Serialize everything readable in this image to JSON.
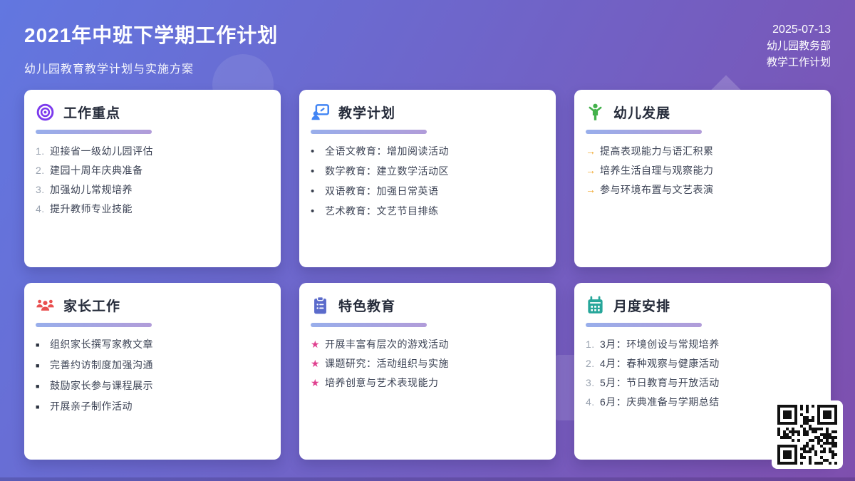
{
  "header": {
    "title": "2021年中班下学期工作计划",
    "subtitle": "幼儿园教育教学计划与实施方案",
    "date": "2025-07-13",
    "department": "幼儿园教务部",
    "doc_type": "教学工作计划"
  },
  "cards": [
    {
      "title": "工作重点",
      "icon": "target-icon",
      "icon_color": "#7c3aed",
      "marker": "number",
      "items": [
        "迎接省一级幼儿园评估",
        "建园十周年庆典准备",
        "加强幼儿常规培养",
        "提升教师专业技能"
      ]
    },
    {
      "title": "教学计划",
      "icon": "presenter-icon",
      "icon_color": "#4285f4",
      "marker": "dot",
      "items": [
        "全语文教育：增加阅读活动",
        "数学教育：建立数学活动区",
        "双语教育：加强日常英语",
        "艺术教育：文艺节目排练"
      ]
    },
    {
      "title": "幼儿发展",
      "icon": "child-icon",
      "icon_color": "#43b14b",
      "marker": "arrow",
      "items": [
        "提高表现能力与语汇积累",
        "培养生活自理与观察能力",
        "参与环境布置与文艺表演"
      ]
    },
    {
      "title": "家长工作",
      "icon": "people-icon",
      "icon_color": "#e94f4f",
      "marker": "square",
      "items": [
        "组织家长撰写家教文章",
        "完善约访制度加强沟通",
        "鼓励家长参与课程展示",
        "开展亲子制作活动"
      ]
    },
    {
      "title": "特色教育",
      "icon": "clipboard-icon",
      "icon_color": "#5b6bcb",
      "marker": "star",
      "items": [
        "开展丰富有层次的游戏活动",
        "课题研究：活动组织与实施",
        "培养创意与艺术表现能力"
      ]
    },
    {
      "title": "月度安排",
      "icon": "calendar-icon",
      "icon_color": "#26a69a",
      "marker": "number",
      "items": [
        "3月：环境创设与常规培养",
        "4月：春种观察与健康活动",
        "5月：节日教育与开放活动",
        "6月：庆典准备与学期总结"
      ]
    }
  ],
  "qr_label": "qr-code",
  "colors": {
    "bg-from": "#6277e0",
    "bg-to": "#7e4fae",
    "card-title": "#252b3a",
    "item-text": "#3d4456",
    "muted-marker": "#9aa3b0",
    "underline-from": "#98aeeb",
    "underline-to": "#b19cd9",
    "arrow": "#f0a21f",
    "star": "#e0408f"
  }
}
